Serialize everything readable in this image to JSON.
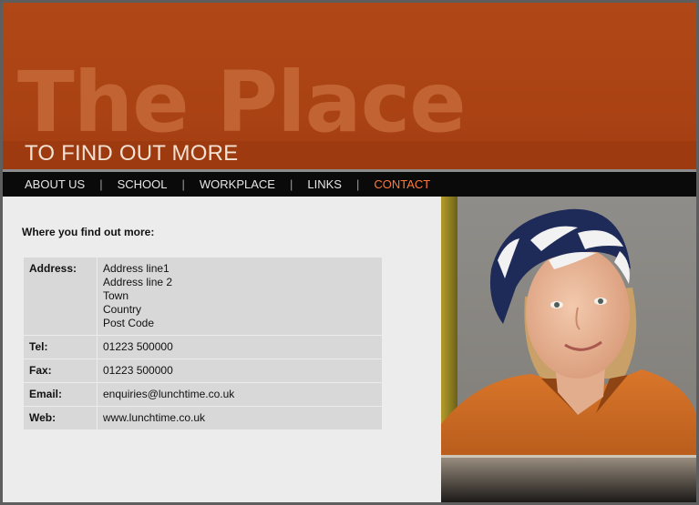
{
  "header": {
    "title": "The Place",
    "subtitle": "TO FIND OUT MORE"
  },
  "nav": {
    "items": [
      {
        "label": "ABOUT US",
        "active": false
      },
      {
        "label": "SCHOOL",
        "active": false
      },
      {
        "label": "WORKPLACE",
        "active": false
      },
      {
        "label": "LINKS",
        "active": false
      },
      {
        "label": "CONTACT",
        "active": true
      }
    ],
    "separator": "|"
  },
  "content": {
    "intro": "Where you find out more:",
    "rows": [
      {
        "label": "Address:",
        "lines": [
          "Address line1",
          "Address line 2",
          "Town",
          "Country",
          "Post Code"
        ]
      },
      {
        "label": "Tel:",
        "lines": [
          "01223 500000"
        ]
      },
      {
        "label": "Fax:",
        "lines": [
          "01223 500000"
        ]
      },
      {
        "label": "Email:",
        "lines": [
          "enquiries@lunchtime.co.uk"
        ]
      },
      {
        "label": "Web:",
        "lines": [
          "www.lunchtime.co.uk"
        ]
      }
    ]
  },
  "colors": {
    "header_bg": "#ab4315",
    "nav_bg": "#0a0a0a",
    "nav_active": "#ff7a3a",
    "content_bg": "#ececec",
    "table_cell": "#d8d8d8"
  },
  "photo": {
    "subject": "smiling woman wearing a navy and white patterned headscarf and an orange shirt"
  }
}
